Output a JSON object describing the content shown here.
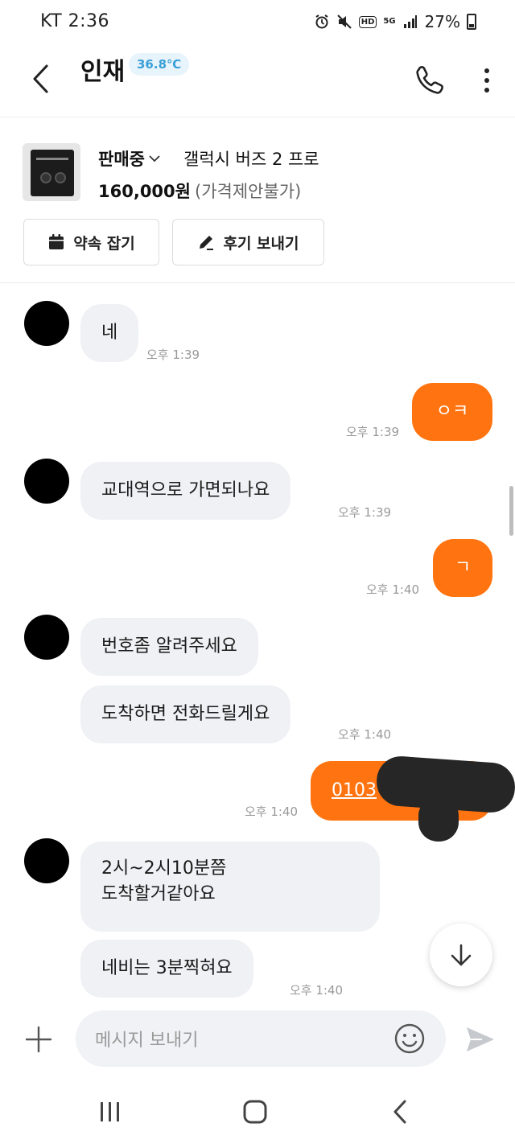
{
  "status_bar": {
    "carrier_time": "KT  2:36",
    "hd": "HD",
    "network": "5G",
    "battery": "27%"
  },
  "header": {
    "title": "인재",
    "temperature": "36.8℃"
  },
  "product": {
    "status": "판매중",
    "name": "갤럭시 버즈 2 프로",
    "price": "160,000원",
    "price_note": "(가격제안불가)",
    "appoint_label": "약속 잡기",
    "review_label": "후기 보내기"
  },
  "messages": [
    {
      "from": "in",
      "text": "네",
      "time": "오후 1:39"
    },
    {
      "from": "out",
      "text": "ㅇㅋ",
      "time": "오후 1:39"
    },
    {
      "from": "in",
      "text": "교대역으로 가면되나요",
      "time": "오후 1:39"
    },
    {
      "from": "out",
      "text": "ㄱ",
      "time": "오후 1:40"
    },
    {
      "from": "in",
      "text": "번호좀 알려주세요",
      "time": ""
    },
    {
      "from": "in",
      "text": "도착하면 전화드릴게요",
      "time": "오후 1:40"
    },
    {
      "from": "out",
      "text": "0103",
      "time": "오후 1:40"
    },
    {
      "from": "in",
      "text": "2시~2시10분쯤\n도착할거같아요",
      "time": ""
    },
    {
      "from": "in",
      "text": "네비는 3분찍혀요",
      "time": "오후 1:40"
    }
  ],
  "composer": {
    "placeholder": "메시지 보내기"
  },
  "colors": {
    "accent": "#ff7410",
    "incoming_bubble": "#f0f1f4",
    "temperature": "#3a9fd8"
  }
}
